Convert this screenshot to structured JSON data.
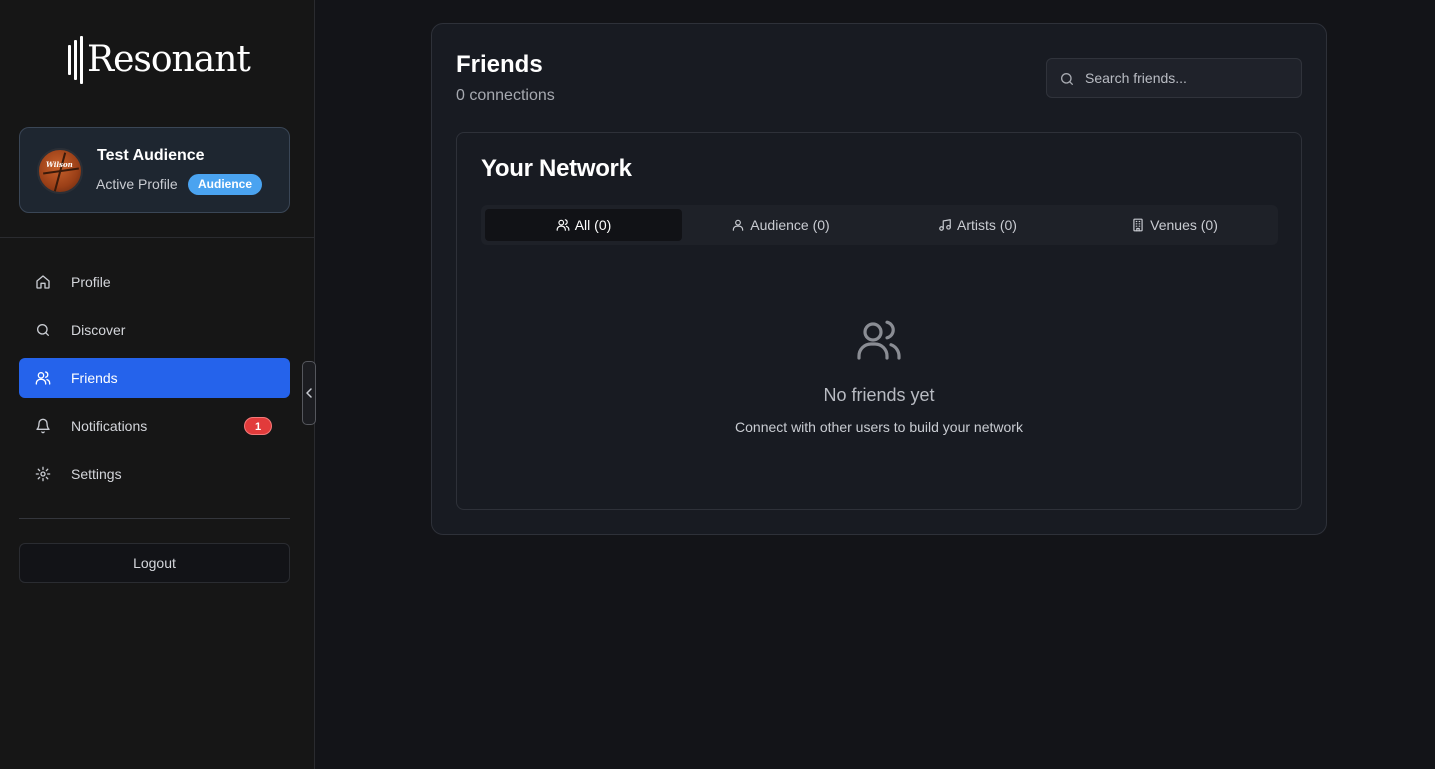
{
  "app": {
    "logo_text": "Resonant"
  },
  "profile": {
    "name": "Test Audience",
    "subtitle": "Active Profile",
    "role_badge": "Audience",
    "avatar_brand": "Wilson"
  },
  "sidebar": {
    "items": [
      {
        "label": "Profile",
        "icon": "home-icon",
        "active": false
      },
      {
        "label": "Discover",
        "icon": "search-icon",
        "active": false
      },
      {
        "label": "Friends",
        "icon": "users-icon",
        "active": true
      },
      {
        "label": "Notifications",
        "icon": "bell-icon",
        "active": false,
        "badge": "1"
      },
      {
        "label": "Settings",
        "icon": "gear-icon",
        "active": false
      }
    ],
    "logout_label": "Logout"
  },
  "main": {
    "title": "Friends",
    "subtitle": "0 connections",
    "search": {
      "placeholder": "Search friends..."
    },
    "network": {
      "title": "Your Network",
      "tabs": [
        {
          "label": "All (0)",
          "icon": "users-icon",
          "active": true
        },
        {
          "label": "Audience (0)",
          "icon": "user-icon",
          "active": false
        },
        {
          "label": "Artists (0)",
          "icon": "music-icon",
          "active": false
        },
        {
          "label": "Venues (0)",
          "icon": "building-icon",
          "active": false
        }
      ],
      "empty": {
        "title": "No friends yet",
        "message": "Connect with other users to build your network"
      }
    }
  },
  "colors": {
    "accent": "#2563eb",
    "badge_blue": "#4aa3f0",
    "badge_red": "#e23b3b",
    "background": "#131418"
  }
}
